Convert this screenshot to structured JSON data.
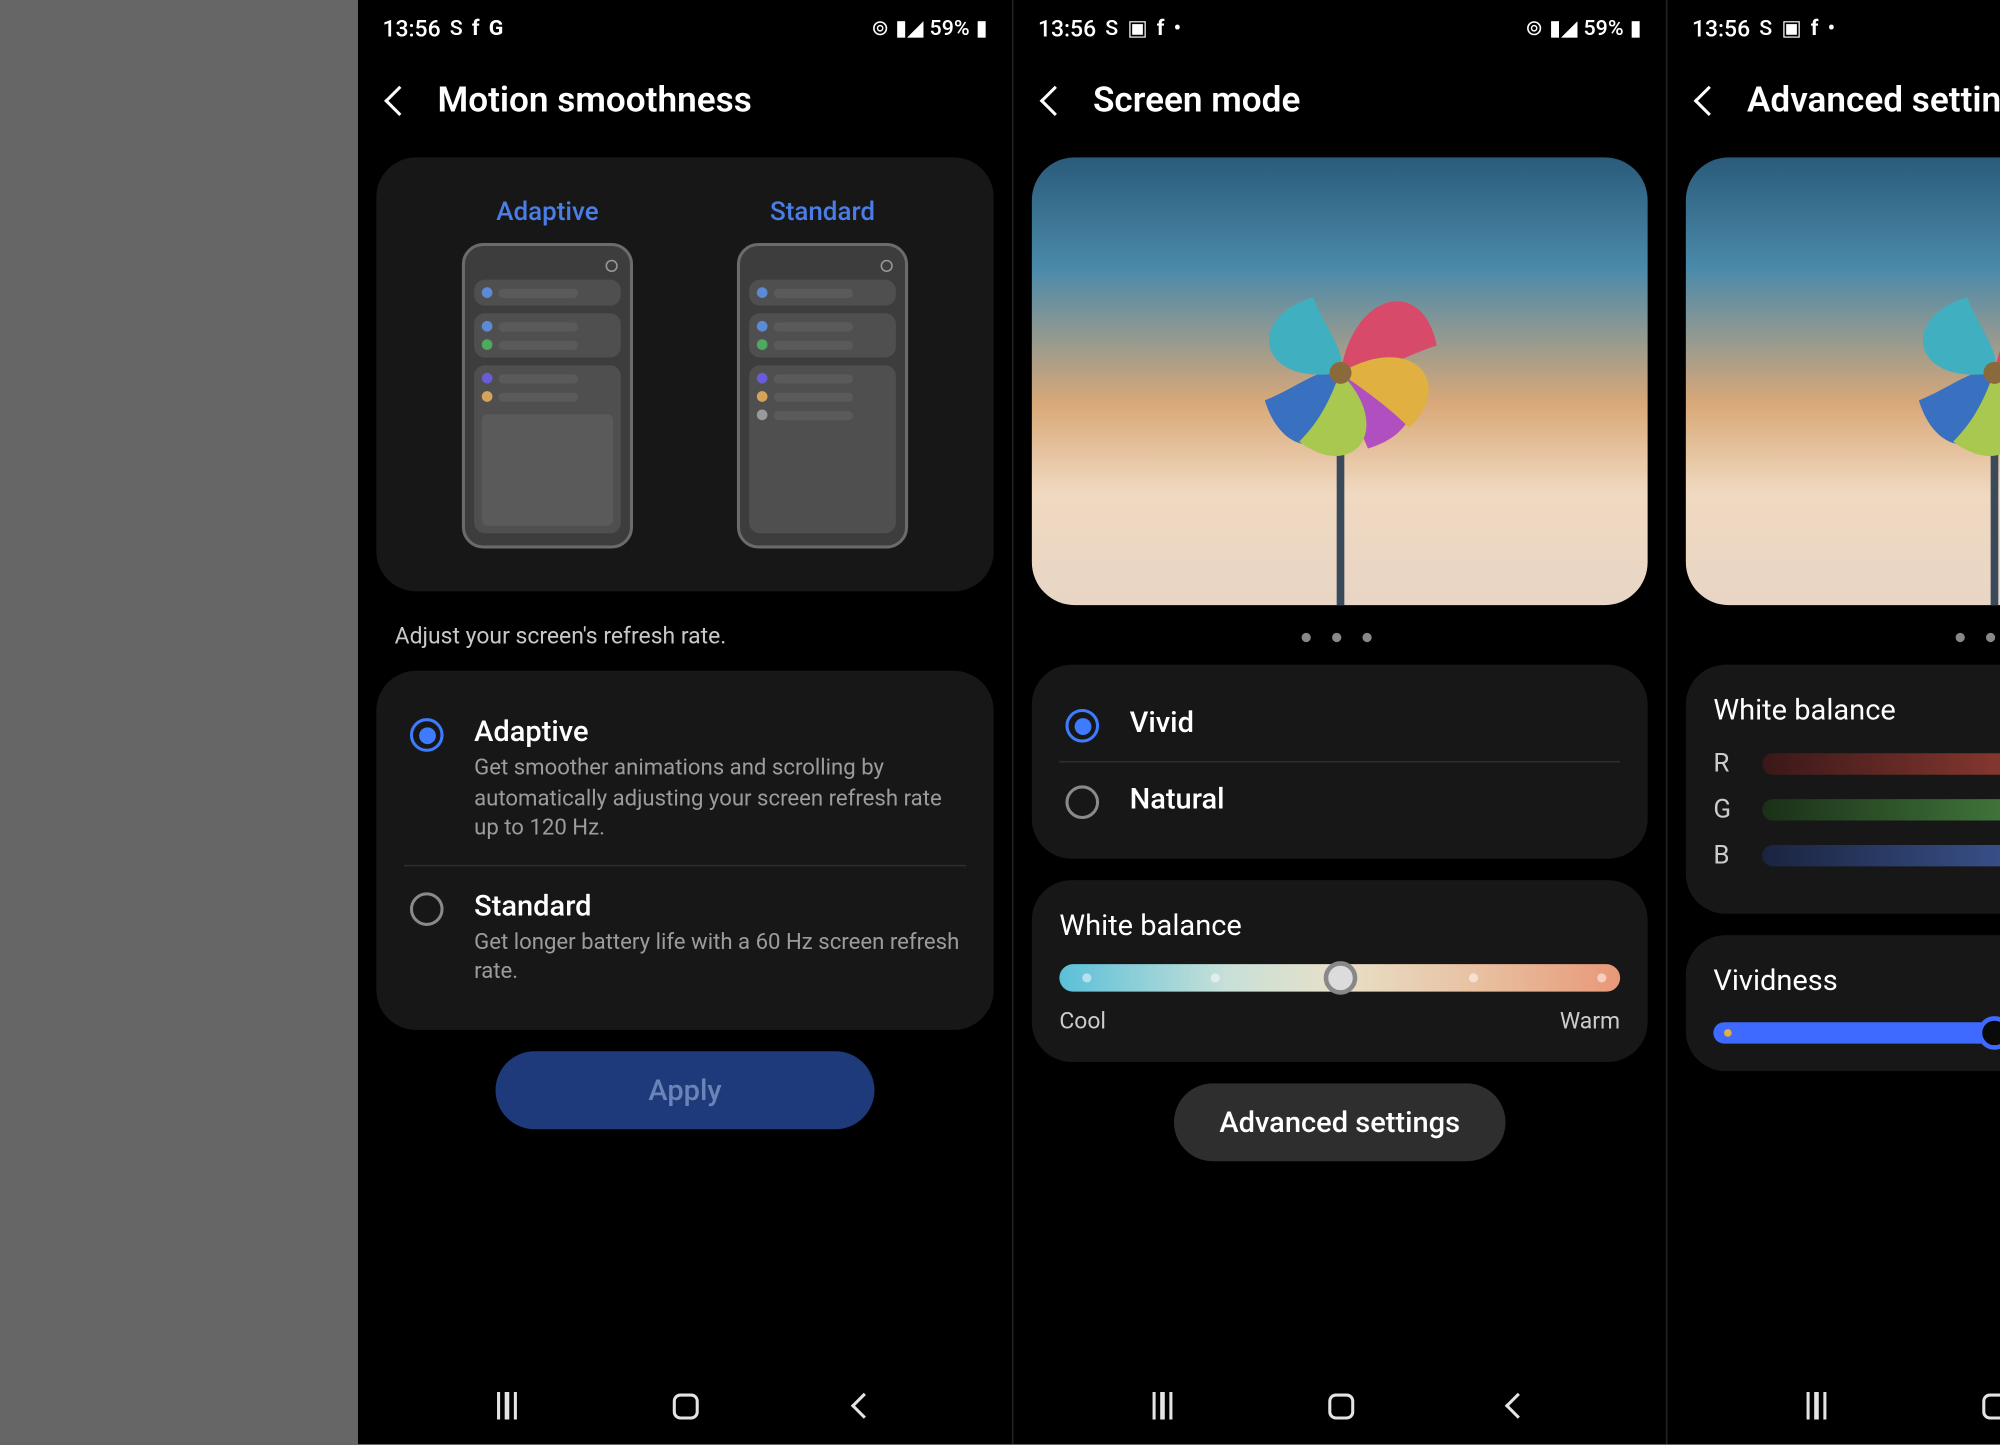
{
  "statusbar": {
    "time": "13:56",
    "battery": "59%",
    "left_icons": [
      "S",
      "f",
      "G"
    ],
    "left_icons_alt": [
      "S",
      "🖼",
      "f",
      "•"
    ]
  },
  "screen1": {
    "title": "Motion smoothness",
    "preview": {
      "adaptive": "Adaptive",
      "standard": "Standard"
    },
    "helper": "Adjust your screen's refresh rate.",
    "options": [
      {
        "title": "Adaptive",
        "desc": "Get smoother animations and scrolling by automatically adjusting your screen refresh rate up to 120 Hz.",
        "selected": true
      },
      {
        "title": "Standard",
        "desc": "Get longer battery life with a 60 Hz screen refresh rate.",
        "selected": false
      }
    ],
    "apply": "Apply"
  },
  "screen2": {
    "title": "Screen mode",
    "dots": "● ● ●",
    "options": [
      {
        "title": "Vivid",
        "selected": true
      },
      {
        "title": "Natural",
        "selected": false
      }
    ],
    "wb": {
      "title": "White balance",
      "cool": "Cool",
      "warm": "Warm",
      "value": 50
    },
    "advanced": "Advanced settings"
  },
  "screen3": {
    "title": "Advanced settings",
    "dots": "● ● ●",
    "wb": {
      "title": "White balance",
      "r": {
        "label": "R",
        "value": 100
      },
      "g": {
        "label": "G",
        "value": 100
      },
      "b": {
        "label": "B",
        "value": 100
      }
    },
    "viv": {
      "title": "Vividness",
      "value": 50
    }
  }
}
